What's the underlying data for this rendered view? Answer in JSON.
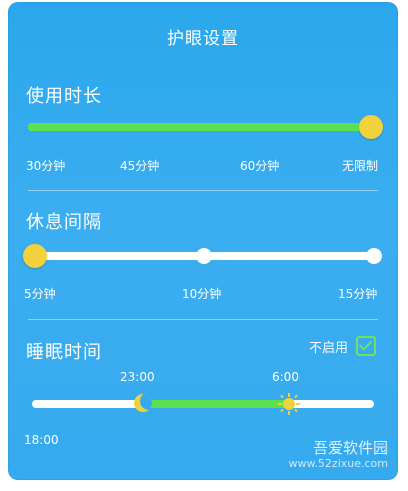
{
  "header": {
    "title": "护眼设置"
  },
  "usage": {
    "title": "使用时长",
    "ticks": [
      "30分钟",
      "45分钟",
      "60分钟",
      "无限制"
    ],
    "selected_fraction": 1.0
  },
  "rest": {
    "title": "休息间隔",
    "ticks": [
      "5分钟",
      "10分钟",
      "15分钟"
    ],
    "selected_fraction": 0.0
  },
  "sleep": {
    "title": "睡眠时间",
    "toggle_label": "不启用",
    "start_time": "23:00",
    "end_time": "6:00",
    "axis_start": "18:00"
  },
  "watermark": {
    "brand": "吾爱软件园",
    "url": "www.52zixue.com"
  },
  "colors": {
    "panel": "#36aaee",
    "accent_green": "#5de04e",
    "knob_yellow": "#f2d23c"
  }
}
